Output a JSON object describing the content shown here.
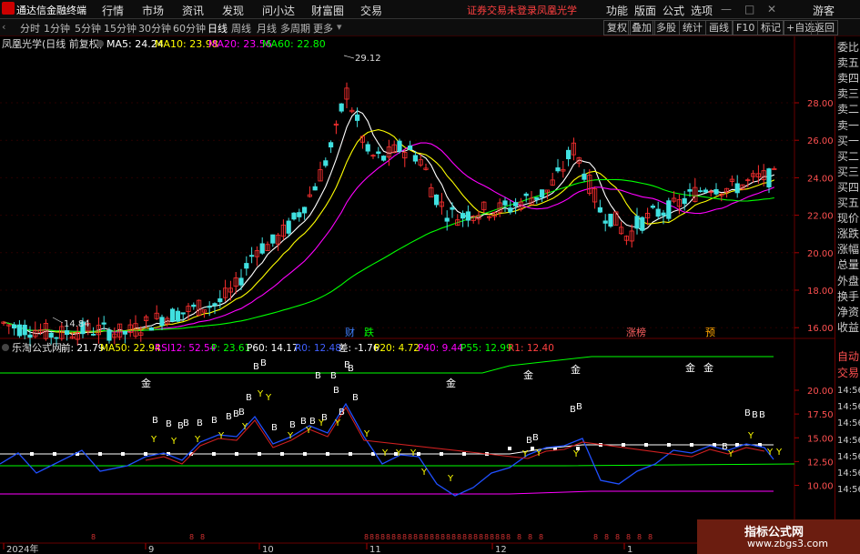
{
  "menubar": {
    "app_name": "通达信金融终端",
    "menus": [
      "行情",
      "市场",
      "资讯",
      "发现",
      "问小达",
      "财富圈",
      "交易"
    ],
    "notice": "证券交易未登录",
    "stock": "凤凰光学",
    "right_menus": [
      "功能",
      "版面",
      "公式",
      "选项"
    ],
    "user": "游客"
  },
  "periodbar": {
    "periods": [
      "分时",
      "1分钟",
      "5分钟",
      "15分钟",
      "30分钟",
      "60分钟",
      "日线",
      "周线",
      "月线",
      "多周期",
      "更多"
    ],
    "active": "日线",
    "tools": [
      "复权",
      "叠加",
      "多股",
      "统计",
      "画线",
      "F10",
      "标记",
      "+自选",
      "返回"
    ]
  },
  "main_chart": {
    "title": "凤凰光学(日线 前复权)",
    "ma": [
      {
        "label": "MA5: 24.24",
        "color": "#ffffff"
      },
      {
        "label": "MA10: 23.98",
        "color": "#ffff00"
      },
      {
        "label": "MA20: 23.56",
        "color": "#ff00ff"
      },
      {
        "label": "MA60: 22.80",
        "color": "#00ff00"
      }
    ],
    "yticks": [
      "28.00",
      "26.00",
      "24.00",
      "22.00",
      "20.00",
      "18.00",
      "16.00"
    ],
    "high_label": "29.12",
    "low_label": "14.84",
    "event_tags": [
      {
        "text": "财",
        "color": "#4080ff"
      },
      {
        "text": "跌",
        "color": "#00ff00"
      },
      {
        "text": "涨榜",
        "color": "#ff6060"
      },
      {
        "text": "预",
        "color": "#ffa500"
      }
    ]
  },
  "sub_chart": {
    "name": "乐淘公式网",
    "stats": [
      {
        "label": "前: 21.79",
        "color": "#ffffff"
      },
      {
        "label": "MA50: 22.94",
        "color": "#ffff00"
      },
      {
        "label": "RSI12: 52.54",
        "color": "#ff00ff"
      },
      {
        "label": "P: 23.61",
        "color": "#00ff00"
      },
      {
        "label": "P60: 14.17",
        "color": "#ffffff"
      },
      {
        "label": "R0: 12.48",
        "color": "#4060ff"
      },
      {
        "label": "差: -1.76",
        "color": "#ffffff"
      },
      {
        "label": "P20: 4.72",
        "color": "#ffff00"
      },
      {
        "label": "P40: 9.44",
        "color": "#ff00ff"
      },
      {
        "label": "P55: 12.99",
        "color": "#00ff00"
      },
      {
        "label": "R1: 12.40",
        "color": "#ff4040"
      }
    ],
    "yticks": [
      "20.00",
      "17.50",
      "15.00",
      "12.50",
      "10.00"
    ],
    "signal_labels": [
      "金",
      "B",
      "Y"
    ]
  },
  "xaxis": {
    "labels": [
      "2024年",
      "9",
      "10",
      "11",
      "12",
      "1"
    ]
  },
  "sidebar": {
    "items": [
      "委比",
      "卖五",
      "卖四",
      "卖三",
      "卖二",
      "卖一",
      "买一",
      "买二",
      "买三",
      "买四",
      "买五",
      "现价",
      "涨跌",
      "涨幅",
      "总量",
      "外盘",
      "换手",
      "净资",
      "收益"
    ],
    "lower_items": [
      "自动",
      "交易",
      "14:56",
      "14:56",
      "14:56",
      "14:56",
      "14:56",
      "14:56",
      "14:56"
    ]
  },
  "watermark": {
    "title": "指标公式网",
    "url": "www.zbgs3.com"
  }
}
